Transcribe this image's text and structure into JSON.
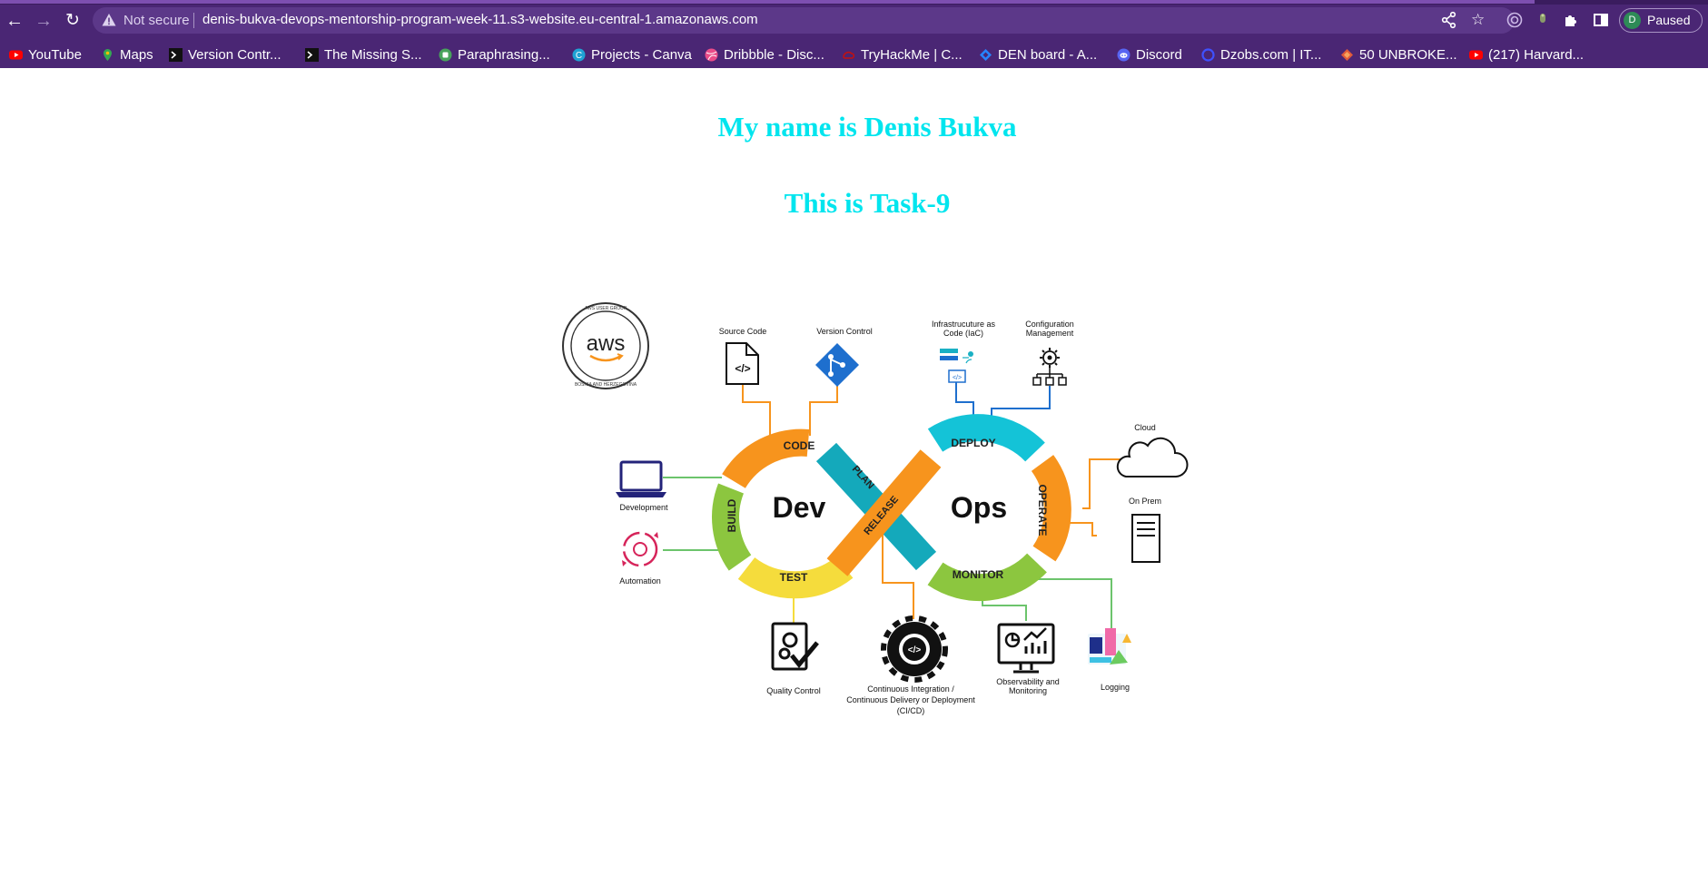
{
  "browser": {
    "security_label": "Not secure",
    "url": "denis-bukva-devops-mentorship-program-week-11.s3-website.eu-central-1.amazonaws.com",
    "profile_initial": "D",
    "profile_label": "Paused",
    "bookmarks": [
      {
        "label": "YouTube",
        "icon": "youtube-icon"
      },
      {
        "label": "Maps",
        "icon": "maps-icon"
      },
      {
        "label": "Version Contr...",
        "icon": "terminal-icon"
      },
      {
        "label": "The Missing S...",
        "icon": "terminal-icon"
      },
      {
        "label": "Paraphrasing...",
        "icon": "quillbot-icon"
      },
      {
        "label": "Projects - Canva",
        "icon": "canva-icon"
      },
      {
        "label": "Dribbble - Disc...",
        "icon": "dribbble-icon"
      },
      {
        "label": "TryHackMe | C...",
        "icon": "tryhackme-icon"
      },
      {
        "label": "DEN board - A...",
        "icon": "jira-icon"
      },
      {
        "label": "Discord",
        "icon": "discord-icon"
      },
      {
        "label": "Dzobs.com | IT...",
        "icon": "dzobs-icon"
      },
      {
        "label": "50 UNBROKE...",
        "icon": "bookmark-icon"
      },
      {
        "label": "(217) Harvard...",
        "icon": "youtube-icon"
      }
    ]
  },
  "page": {
    "heading_name": "My name is Denis Bukva",
    "heading_task": "This is Task-9"
  },
  "diagram": {
    "aws_logo": {
      "wordmark": "aws",
      "ring_text_top": "AWS USER GROUP",
      "ring_text_bottom": "BOSNIA AND HERZEGOVINA"
    },
    "center_dev": "Dev",
    "center_ops": "Ops",
    "stages": {
      "code": "CODE",
      "plan": "PLAN",
      "build": "BUILD",
      "test": "TEST",
      "release": "RELEASE",
      "deploy": "DEPLOY",
      "operate": "OPERATE",
      "monitor": "MONITOR"
    },
    "labels": {
      "source_code": "Source Code",
      "version_control": "Version Control",
      "iac_line1": "Infrastrucuture as",
      "iac_line2": "Code (IaC)",
      "config_line1": "Configuration",
      "config_line2": "Management",
      "cloud": "Cloud",
      "on_prem": "On Prem",
      "development": "Development",
      "automation": "Automation",
      "quality_control": "Quality Control",
      "cicd_line1": "Continuous Integration /",
      "cicd_line2": "Continuous Delivery or Deployment",
      "cicd_line3": "(CI/CD)",
      "observability_line1": "Observability and",
      "observability_line2": "Monitoring",
      "logging": "Logging"
    },
    "colors": {
      "orange": "#f7941d",
      "teal": "#1ab0c4",
      "cyan": "#14c3d7",
      "green": "#8cc63f",
      "yellow": "#f5dc3c",
      "line_green": "#6cc46c",
      "git_blue": "#1e6fce",
      "heading_cyan": "#00e5ee",
      "chrome_purple": "#4a2674"
    }
  }
}
